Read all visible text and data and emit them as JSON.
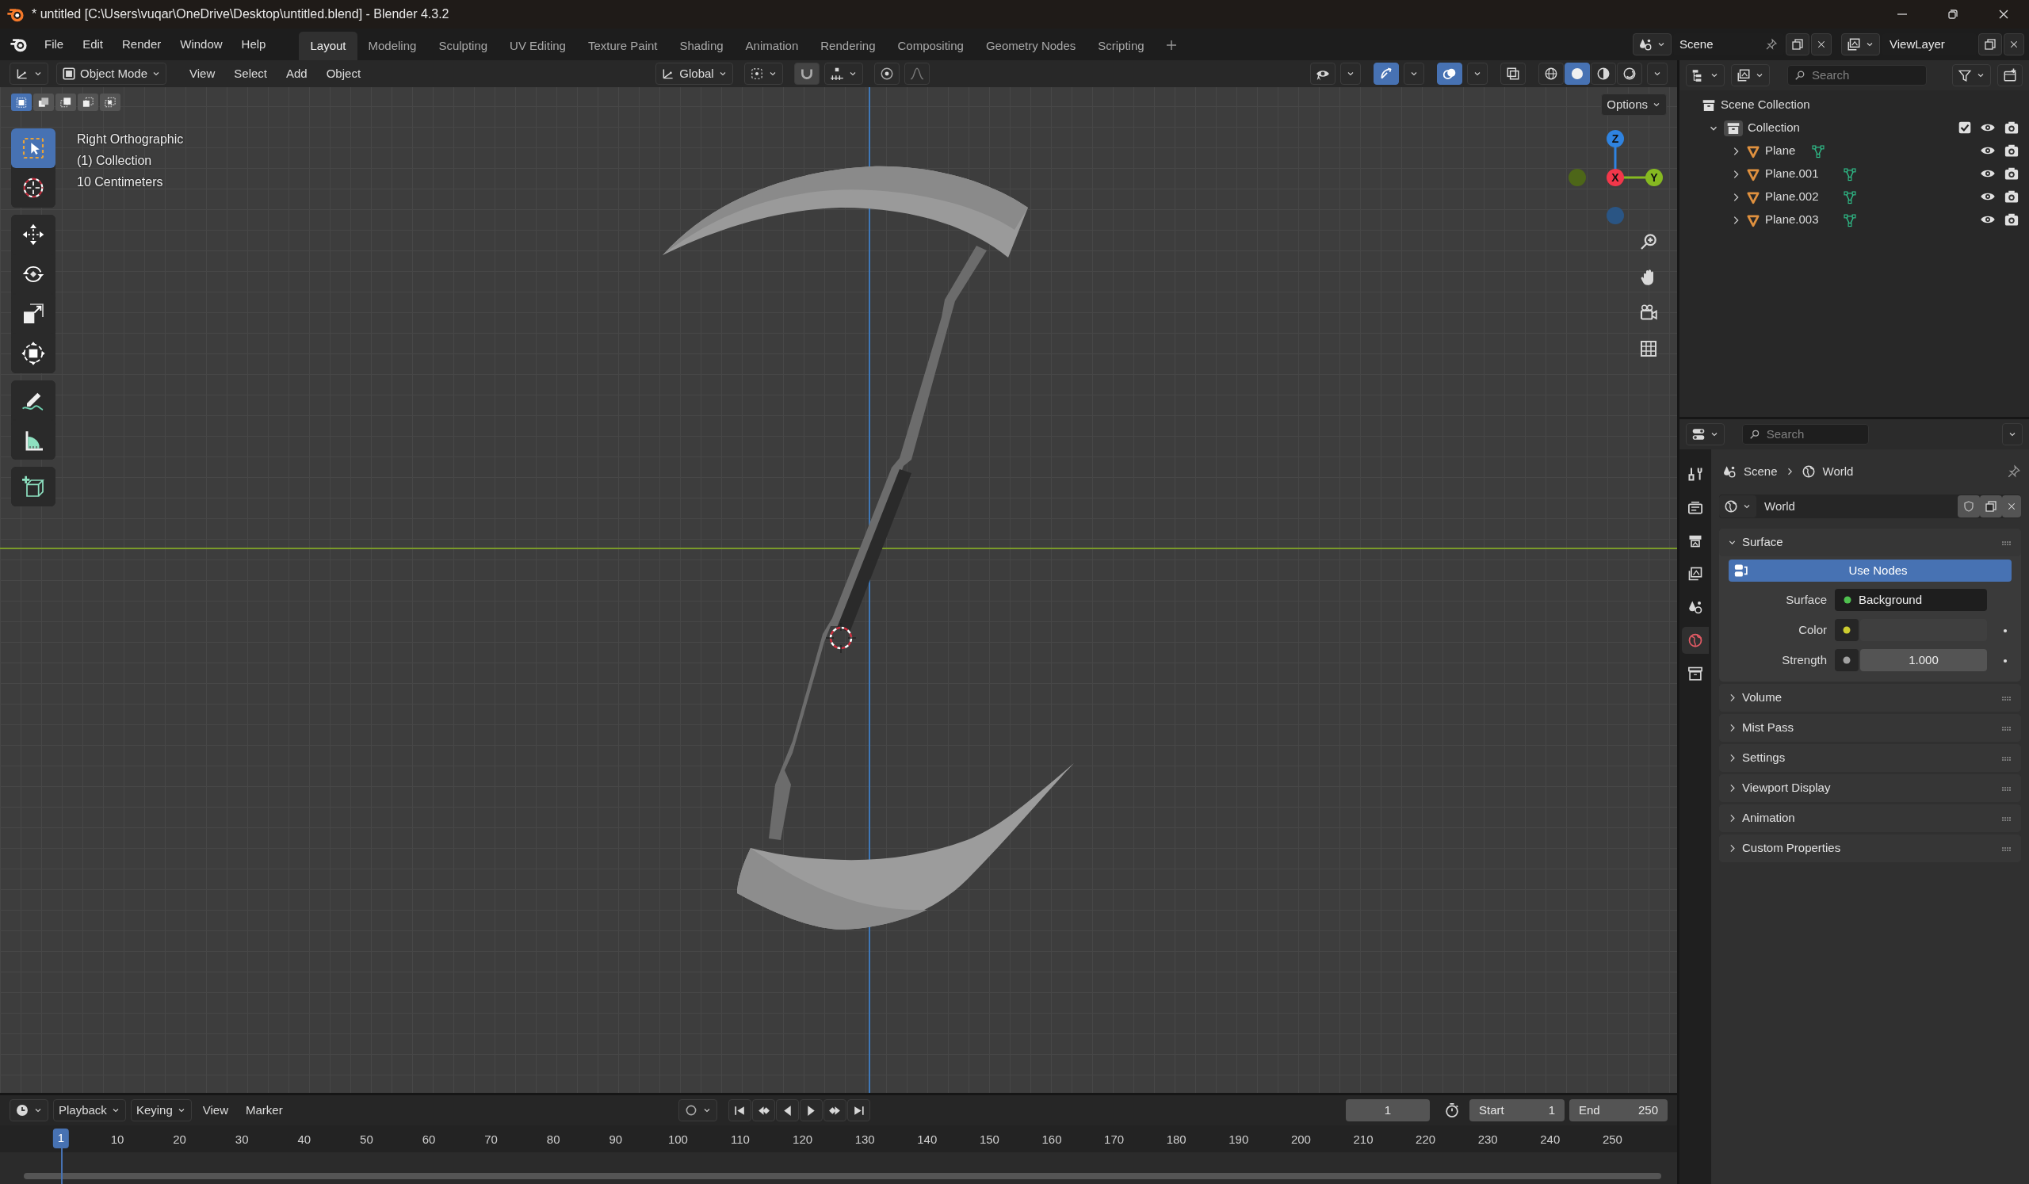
{
  "window": {
    "title": "* untitled [C:\\Users\\vuqar\\OneDrive\\Desktop\\untitled.blend] - Blender 4.3.2"
  },
  "menu": [
    "File",
    "Edit",
    "Render",
    "Window",
    "Help"
  ],
  "workspaces": [
    {
      "label": "Layout",
      "selected": true
    },
    {
      "label": "Modeling",
      "selected": false
    },
    {
      "label": "Sculpting",
      "selected": false
    },
    {
      "label": "UV Editing",
      "selected": false
    },
    {
      "label": "Texture Paint",
      "selected": false
    },
    {
      "label": "Shading",
      "selected": false
    },
    {
      "label": "Animation",
      "selected": false
    },
    {
      "label": "Rendering",
      "selected": false
    },
    {
      "label": "Compositing",
      "selected": false
    },
    {
      "label": "Geometry Nodes",
      "selected": false
    },
    {
      "label": "Scripting",
      "selected": false
    }
  ],
  "scene": "Scene",
  "view_layer": "ViewLayer",
  "viewport": {
    "mode": "Object Mode",
    "menus": [
      "View",
      "Select",
      "Add",
      "Object"
    ],
    "orientation": "Global",
    "options": "Options",
    "select_modes": [
      {
        "kind": "set",
        "selected": true
      },
      {
        "kind": "extend",
        "selected": false
      },
      {
        "kind": "subtract",
        "selected": false
      },
      {
        "kind": "invert",
        "selected": false
      },
      {
        "kind": "intersect",
        "selected": false
      }
    ],
    "toggles": [
      {
        "kind": "visibility",
        "on": false
      },
      {
        "kind": "gizmos",
        "on": true
      },
      {
        "kind": "overlays",
        "on": true
      },
      {
        "kind": "xray",
        "on": false
      }
    ],
    "shading": [
      {
        "kind": "wireframe",
        "selected": false
      },
      {
        "kind": "solid",
        "selected": true
      },
      {
        "kind": "material",
        "selected": false
      },
      {
        "kind": "rendered",
        "selected": false
      }
    ],
    "tool_groups": [
      [
        {
          "kind": "select",
          "selected": true
        },
        {
          "kind": "cursor",
          "selected": false
        }
      ],
      [
        {
          "kind": "move",
          "selected": false
        },
        {
          "kind": "rotate",
          "selected": false
        },
        {
          "kind": "scale",
          "selected": false
        },
        {
          "kind": "transform",
          "selected": false
        }
      ],
      [
        {
          "kind": "annotate",
          "selected": false
        },
        {
          "kind": "measure",
          "selected": false
        }
      ],
      [
        {
          "kind": "add-cube",
          "selected": false
        }
      ]
    ],
    "overlay_lines": [
      "Right Orthographic",
      "(1) Collection",
      "10 Centimeters"
    ],
    "gizmo": [
      {
        "label": "Z",
        "color": "#2f83e0"
      },
      {
        "label": "X",
        "color": "#f2374a"
      },
      {
        "label": "Y",
        "color": "#86b921"
      }
    ]
  },
  "outliner": {
    "search_placeholder": "Search",
    "root": "Scene Collection",
    "tree": [
      {
        "label": "Collection",
        "expanded": true,
        "checked": true,
        "children": [
          {
            "label": "Plane",
            "expanded": false
          },
          {
            "label": "Plane.001",
            "expanded": false
          },
          {
            "label": "Plane.002",
            "expanded": false
          },
          {
            "label": "Plane.003",
            "expanded": false
          }
        ]
      }
    ]
  },
  "properties": {
    "search_placeholder": "Search",
    "breadcrumb": [
      "Scene",
      "World"
    ],
    "world": "World",
    "tabs": [
      {
        "kind": "tool",
        "selected": false
      },
      {
        "kind": "render",
        "selected": false
      },
      {
        "kind": "output",
        "selected": false
      },
      {
        "kind": "view-layer",
        "selected": false
      },
      {
        "kind": "scene",
        "selected": false
      },
      {
        "kind": "world",
        "selected": true
      },
      {
        "kind": "collection",
        "selected": false
      }
    ],
    "use_nodes": "Use Nodes",
    "fields": [
      {
        "label": "Surface",
        "value": "Background",
        "color": "#4fc04f",
        "kind": "shader"
      },
      {
        "label": "Color",
        "color": "#cccc30",
        "kind": "color"
      },
      {
        "label": "Strength",
        "value": "1.000",
        "color": "#a1a1a1",
        "kind": "number"
      }
    ],
    "panels": [
      {
        "title": "Surface",
        "expanded": true
      },
      {
        "title": "Volume",
        "expanded": false
      },
      {
        "title": "Mist Pass",
        "expanded": false
      },
      {
        "title": "Settings",
        "expanded": false
      },
      {
        "title": "Viewport Display",
        "expanded": false
      },
      {
        "title": "Animation",
        "expanded": false
      },
      {
        "title": "Custom Properties",
        "expanded": false
      }
    ]
  },
  "timeline": {
    "menus": [
      "Playback",
      "Keying",
      "View",
      "Marker"
    ],
    "current_frame": "1",
    "start_label": "Start",
    "start": "1",
    "end_label": "End",
    "end": "250",
    "playhead": "1",
    "ticks": [
      "10",
      "20",
      "30",
      "40",
      "50",
      "60",
      "70",
      "80",
      "90",
      "100",
      "110",
      "120",
      "130",
      "140",
      "150",
      "160",
      "170",
      "180",
      "190",
      "200",
      "210",
      "220",
      "230",
      "240",
      "250"
    ]
  }
}
